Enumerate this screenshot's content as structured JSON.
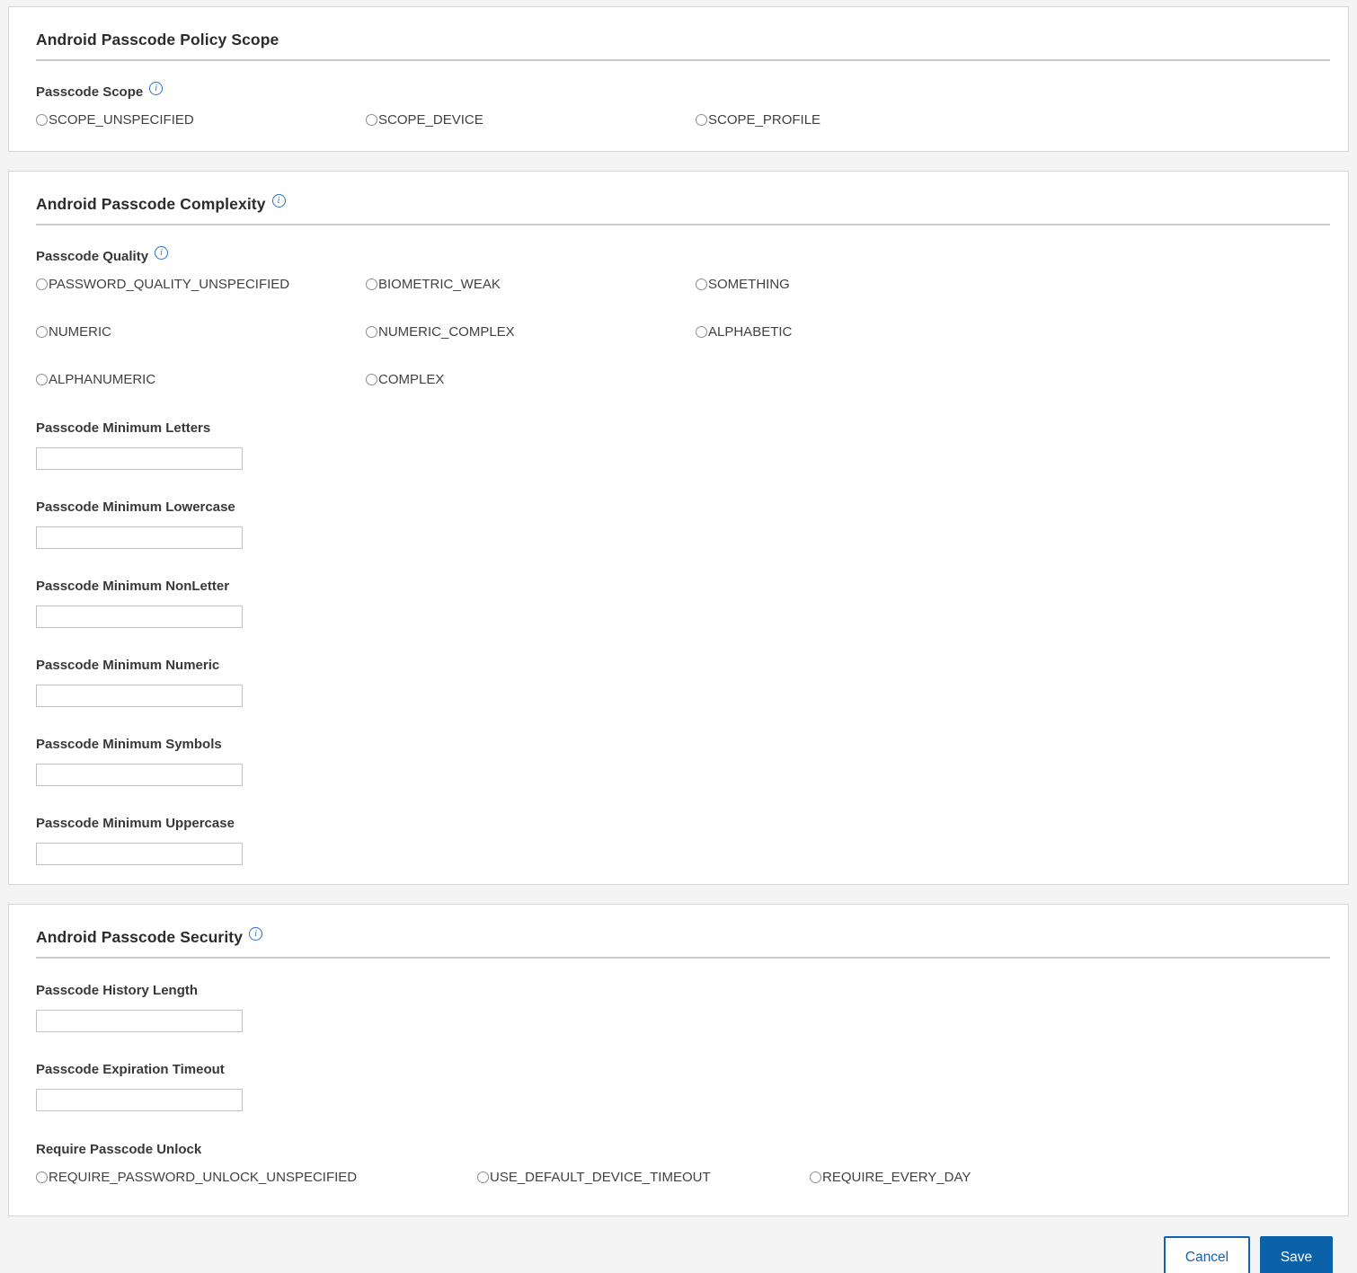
{
  "colors": {
    "accent_blue": "#0c62a8",
    "cancel_blue": "#1261b4",
    "info_icon_blue": "#2b70d0",
    "page_background": "#f4f4f4",
    "panel_background": "#ffffff"
  },
  "icons": {
    "info_glyph": "i"
  },
  "sections": [
    {
      "title": "Android Passcode Policy Scope",
      "fields": [
        {
          "label": "Passcode Scope",
          "type": "radio-group",
          "selected": "",
          "options": [
            "SCOPE_UNSPECIFIED",
            "SCOPE_DEVICE",
            "SCOPE_PROFILE"
          ]
        }
      ]
    },
    {
      "title": "Android Passcode Complexity",
      "fields": [
        {
          "label": "Passcode Quality",
          "type": "radio-group",
          "selected": "",
          "options": [
            "PASSWORD_QUALITY_UNSPECIFIED",
            "BIOMETRIC_WEAK",
            "SOMETHING",
            "NUMERIC",
            "NUMERIC_COMPLEX",
            "ALPHABETIC",
            "ALPHANUMERIC",
            "COMPLEX"
          ]
        },
        {
          "label": "Passcode Minimum Letters",
          "type": "text-input",
          "value": ""
        },
        {
          "label": "Passcode Minimum Lowercase",
          "type": "text-input",
          "value": ""
        },
        {
          "label": "Passcode Minimum NonLetter",
          "type": "text-input",
          "value": ""
        },
        {
          "label": "Passcode Minimum Numeric",
          "type": "text-input",
          "value": ""
        },
        {
          "label": "Passcode Minimum Symbols",
          "type": "text-input",
          "value": ""
        },
        {
          "label": "Passcode Minimum Uppercase",
          "type": "text-input",
          "value": ""
        }
      ]
    },
    {
      "title": "Android Passcode Security",
      "fields": [
        {
          "label": "Passcode History Length",
          "type": "text-input",
          "value": ""
        },
        {
          "label": "Passcode Expiration Timeout",
          "type": "text-input",
          "value": ""
        },
        {
          "label": "Require Passcode Unlock",
          "type": "radio-group",
          "selected": "",
          "options": [
            "REQUIRE_PASSWORD_UNLOCK_UNSPECIFIED",
            "USE_DEFAULT_DEVICE_TIMEOUT",
            "REQUIRE_EVERY_DAY"
          ]
        }
      ]
    }
  ],
  "footer": {
    "cancel_label": "Cancel",
    "save_label": "Save"
  }
}
